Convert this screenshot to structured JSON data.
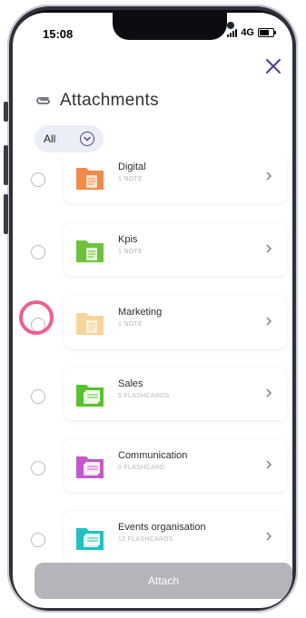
{
  "status": {
    "time": "15:08",
    "network": "4G"
  },
  "header": {
    "title": "Attachments"
  },
  "filter": {
    "label": "All"
  },
  "items": [
    {
      "name": "Digital",
      "meta": "1 NOTE",
      "color": "#f28a4b"
    },
    {
      "name": "Kpis",
      "meta": "1 NOTE",
      "color": "#6dc23a"
    },
    {
      "name": "Marketing",
      "meta": "1 NOTE",
      "color": "#f6d49a"
    },
    {
      "name": "Sales",
      "meta": "5 FLASHCARDS",
      "color": "#56c22f"
    },
    {
      "name": "Communication",
      "meta": "0 FLASHCARD",
      "color": "#c05ac8"
    },
    {
      "name": "Events organisation",
      "meta": "12 FLASHCARDS",
      "color": "#22c0c0"
    }
  ],
  "attach_button": {
    "label": "Attach"
  },
  "colors": {
    "accent": "#4e3b8c",
    "highlight": "#ef5f91"
  }
}
